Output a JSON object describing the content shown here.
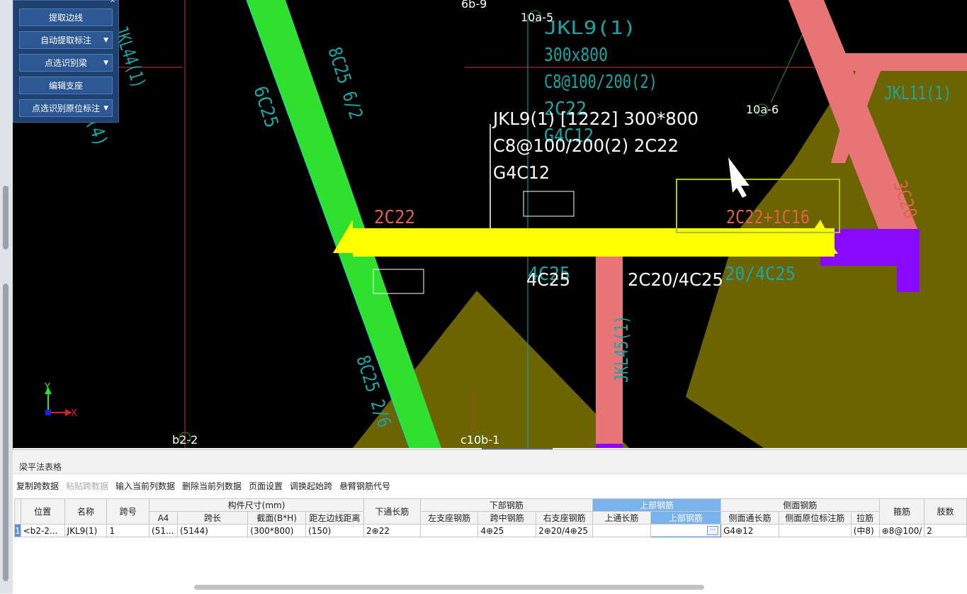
{
  "toolbar_panel": {
    "buttons": [
      {
        "label": "提取边线",
        "has_dropdown": false
      },
      {
        "label": "自动提取标注",
        "has_dropdown": true
      },
      {
        "label": "点选识别梁",
        "has_dropdown": true
      },
      {
        "label": "编辑支座",
        "has_dropdown": false
      },
      {
        "label": "点选识别原位标注",
        "has_dropdown": true
      }
    ]
  },
  "canvas": {
    "labels": {
      "axis_6b9": "6b-9",
      "axis_10a5": "10a-5",
      "axis_10a6": "10a-6",
      "axis_b22": "b2-2",
      "axis_c10b1": "c10b-1",
      "jkl9_l1": "JKL9(1)",
      "jkl9_l2": "300x800",
      "jkl9_l3": "C8@100/200(2)",
      "jkl9_l4": "2C22",
      "jkl9_l5": "G4C12",
      "jkl11": "JKL11(1)",
      "jkl44": "JKL44(1)",
      "jkl45": "JKL45(1)",
      "left_4": "(4)",
      "c8c25_top": "8C25 6/2",
      "c6c25": "6C25",
      "c8c25_bot": "8C25 2/6",
      "c3c20": "3C20",
      "c4c25": "4C25",
      "c20_4c25": "20/4C25"
    },
    "info_lines": [
      "JKL9(1) [1222] 300*800",
      "C8@100/200(2) 2C22",
      "G4C12"
    ],
    "left_support_rebar": "2C22",
    "right_support_rebar": "2C22+1C16",
    "bottom_mid_rebar": "4C25",
    "bottom_right_rebar": "2C20/4C25",
    "ucs": {
      "x": "X",
      "y": "Y"
    },
    "colors": {
      "background": "#000000",
      "green_beam": "#2fe02f",
      "pink_beam": "#e87575",
      "yellow_beam": "#ffff00",
      "purple_col": "#8a0aff",
      "olive_slab": "#6b6400",
      "cyan_text": "#1aa6a6",
      "red_text": "#e0624a"
    }
  },
  "bottom_panel": {
    "title": "梁平法表格",
    "toolbar": [
      {
        "label": "复制跨数据",
        "enabled": true
      },
      {
        "label": "粘贴跨数据",
        "enabled": false
      },
      {
        "label": "输入当前列数据",
        "enabled": true
      },
      {
        "label": "删除当前列数据",
        "enabled": true
      },
      {
        "label": "页面设置",
        "enabled": true
      },
      {
        "label": "调换起始跨",
        "enabled": true
      },
      {
        "label": "悬臂钢筋代号",
        "enabled": true
      }
    ],
    "table": {
      "group_headers": {
        "position": "位置",
        "name": "名称",
        "span_no": "跨号",
        "size": "构件尺寸(mm)",
        "bottom_through": "下通长筋",
        "bottom_rebar": "下部钢筋",
        "top_rebar": "上部钢筋",
        "side_rebar": "侧面钢筋",
        "stirrup": "箍筋",
        "legs": "肢数"
      },
      "sub_headers": {
        "a4": "A4",
        "span_len": "跨长",
        "section": "截面(B*H)",
        "edge_dist": "距左边线距离",
        "left_support": "左支座钢筋",
        "mid_span": "跨中钢筋",
        "right_support": "右支座钢筋",
        "top_through": "上通长筋",
        "top_rebar": "上部钢筋",
        "side_through": "侧面通长筋",
        "side_orig": "侧面原位标注筋",
        "tie": "拉筋"
      },
      "row": {
        "rownum": "1",
        "position": "<b2-2...",
        "name": "JKL9(1)",
        "span_no": "1",
        "a4": "(51...",
        "span_len": "(5144)",
        "section": "(300*800)",
        "edge_dist": "(150)",
        "bottom_through": "2⊕22",
        "left_support": "",
        "mid_span": "4⊕25",
        "right_support": "2⊕20/4⊕25",
        "top_through": "",
        "top_rebar": "",
        "side_through": "G4⊕12",
        "side_orig": "",
        "tie": "(中8)",
        "stirrup": "⊕8@100/",
        "legs": "2"
      }
    }
  }
}
